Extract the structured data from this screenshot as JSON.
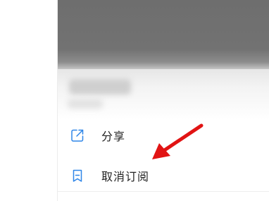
{
  "menu": {
    "items": [
      {
        "label": "分享",
        "icon": "share-icon"
      },
      {
        "label": "取消订阅",
        "icon": "bookmark-icon"
      }
    ]
  },
  "colors": {
    "icon_accent": "#2f86e8",
    "arrow": "#e11414",
    "text": "#222222"
  }
}
